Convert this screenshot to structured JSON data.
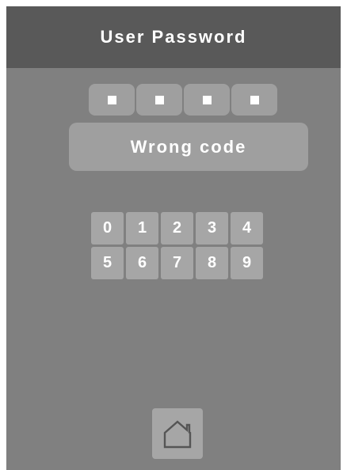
{
  "header": {
    "title": "User Password"
  },
  "pin": {
    "slots": [
      "",
      "",
      "",
      ""
    ]
  },
  "message": {
    "text": "Wrong code"
  },
  "keypad": {
    "keys": [
      "0",
      "1",
      "2",
      "3",
      "4",
      "5",
      "6",
      "7",
      "8",
      "9"
    ]
  },
  "home": {
    "icon": "home-icon"
  },
  "colors": {
    "background": "#808080",
    "header": "#595959",
    "button": "#a6a6a6",
    "text": "#ffffff"
  }
}
